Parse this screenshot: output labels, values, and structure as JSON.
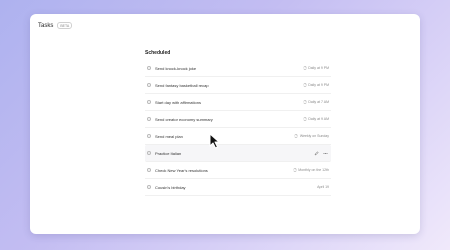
{
  "header": {
    "title": "Tasks",
    "badge": "BETA"
  },
  "section": {
    "title": "Scheduled",
    "tasks": [
      {
        "label": "Send knock-knock joke",
        "meta": "Daily at 9 PM",
        "repeat": true
      },
      {
        "label": "Send fantasy basketball recap",
        "meta": "Daily at 9 PM",
        "repeat": true
      },
      {
        "label": "Start day with affirmations",
        "meta": "Daily at 7 AM",
        "repeat": true
      },
      {
        "label": "Send creator economy summary",
        "meta": "Daily at 9 AM",
        "repeat": true
      },
      {
        "label": "Send meal plan",
        "meta": "Weekly on Sunday",
        "repeat": true
      },
      {
        "label": "Practice Italian",
        "meta": "",
        "repeat": false
      },
      {
        "label": "Check New Year's resolutions",
        "meta": "Monthly on the 12th",
        "repeat": true
      },
      {
        "label": "Cousin's birthday",
        "meta": "April 19",
        "repeat": false
      }
    ]
  }
}
